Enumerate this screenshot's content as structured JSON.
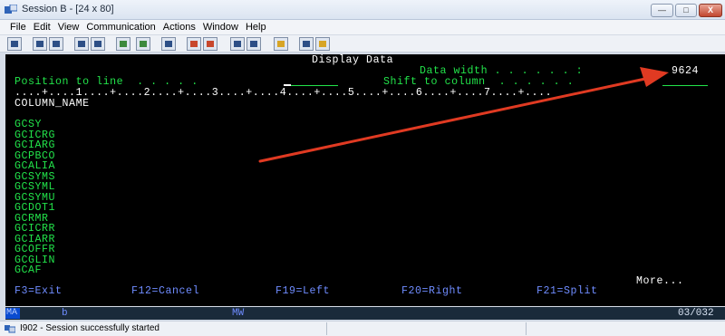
{
  "window": {
    "title": "Session B - [24 x 80]",
    "minimize": "—",
    "maximize": "□",
    "close": "X"
  },
  "menu": [
    "File",
    "Edit",
    "View",
    "Communication",
    "Actions",
    "Window",
    "Help"
  ],
  "toolbar_icons": [
    "print-icon",
    "copy-icon",
    "paste-icon",
    "send-icon",
    "receive-icon",
    "display-icon",
    "macro-icon",
    "record-icon",
    "play-icon",
    "keyboard-icon",
    "color-icon",
    "help-icon",
    "settings-icon",
    "quick-icon"
  ],
  "screen": {
    "title": "Display Data",
    "data_width_label": "Data width . . . . . . :",
    "data_width_value": "9624",
    "position_label": "Position to line  . . . . .",
    "shift_label": "Shift to column  . . . . . .",
    "ruler": "....+....1....+....2....+....3....+....4....+....5....+....6....+....7....+....",
    "column_header": "COLUMN_NAME",
    "rows": [
      "GCSY",
      "GCICRG",
      "GCIARG",
      "GCPBCO",
      "GCALIA",
      "GCSYMS",
      "GCSYML",
      "GCSYMU",
      "GCDOT1",
      "GCRMR",
      "GCICRR",
      "GCIARR",
      "GCOFFR",
      "GCGLIN",
      "GCAF"
    ],
    "more": "More...",
    "fkeys": {
      "f3": "F3=Exit",
      "f12": "F12=Cancel",
      "f19": "F19=Left",
      "f20": "F20=Right",
      "f21": "F21=Split"
    }
  },
  "oia": {
    "ma": "MA",
    "indicator": "b",
    "mw": "MW",
    "cursor_pos": "03/032"
  },
  "status": {
    "message": "I902 - Session successfully started"
  },
  "colors": {
    "terminal_bg": "#000000",
    "text_green": "#22e34a",
    "text_white": "#ffffff",
    "annotation_arrow": "#e03a22"
  }
}
